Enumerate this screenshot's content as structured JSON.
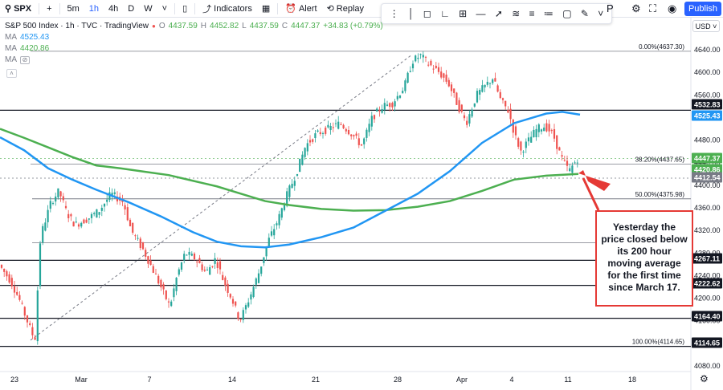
{
  "toolbar": {
    "symbol": "SPX",
    "intervals": [
      {
        "label": "5m"
      },
      {
        "label": "1h"
      },
      {
        "label": "4h"
      },
      {
        "label": "D"
      },
      {
        "label": "W"
      }
    ],
    "indicators_label": "Indicators",
    "alert_label": "Alert",
    "replay_label": "Replay",
    "publish_label": "Publish",
    "letter_p": "P"
  },
  "colors": {
    "accent": "#2962ff",
    "up": "#26a69a",
    "down": "#ef5350",
    "ma_fast": "#2196f3",
    "ma_slow": "#4caf50",
    "callout": "#e53935"
  },
  "legend": {
    "title": "S&P 500 Index · 1h · TVC · TradingView",
    "ohlc": {
      "o": "4437.59",
      "h": "4452.82",
      "l": "4437.59",
      "c": "4447.37",
      "chg": "+34.83 (+0.79%)"
    },
    "ma1": {
      "name": "MA",
      "value": "4525.43"
    },
    "ma2": {
      "name": "MA",
      "value": "4420.86"
    }
  },
  "currency": "USD",
  "annotation": "Yesterday the price closed below its 200 hour moving average for the first time since March 17.",
  "chart_data": {
    "type": "candlestick",
    "ylim": [
      4050,
      4660
    ],
    "x_ticks": [
      "23",
      "Mar",
      "7",
      "14",
      "21",
      "28",
      "Apr",
      "4",
      "11",
      "18"
    ],
    "y_ticks": [
      4640,
      4600,
      4560,
      4520,
      4480,
      4440,
      4400,
      4360,
      4320,
      4280,
      4240,
      4200,
      4160,
      4120,
      4080
    ],
    "fib_levels": [
      {
        "label": "0.00%(4637.30)",
        "value": 4637.3
      },
      {
        "label": "38.20%(4437.65)",
        "value": 4437.65
      },
      {
        "label": "50.00%(4375.98)",
        "value": 4375.98
      },
      {
        "label": "100.00%(4114.65)",
        "value": 4114.65
      }
    ],
    "horizontal_lines": [
      4532.83,
      4267.11,
      4222.62,
      4164.4,
      4114.65
    ],
    "price_labels": [
      {
        "text": "4532.83",
        "color": "#131722"
      },
      {
        "text": "4525.43",
        "color": "#2196f3"
      },
      {
        "text": "4447.37",
        "color": "#4caf50"
      },
      {
        "text": "4420.86",
        "color": "#4caf50"
      },
      {
        "text": "4412.54",
        "color": "#787b86"
      },
      {
        "text": "4267.11",
        "color": "#131722"
      },
      {
        "text": "4222.62",
        "color": "#131722"
      },
      {
        "text": "4164.40",
        "color": "#131722"
      },
      {
        "text": "4114.65",
        "color": "#131722"
      }
    ],
    "prices_path": [
      [
        0,
        4260
      ],
      [
        5,
        4250
      ],
      [
        15,
        4230
      ],
      [
        25,
        4200
      ],
      [
        38,
        4150
      ],
      [
        45,
        4125
      ],
      [
        52,
        4310
      ],
      [
        65,
        4370
      ],
      [
        75,
        4390
      ],
      [
        85,
        4350
      ],
      [
        95,
        4330
      ],
      [
        110,
        4340
      ],
      [
        125,
        4355
      ],
      [
        140,
        4385
      ],
      [
        155,
        4370
      ],
      [
        165,
        4320
      ],
      [
        180,
        4285
      ],
      [
        192,
        4250
      ],
      [
        205,
        4210
      ],
      [
        213,
        4185
      ],
      [
        222,
        4240
      ],
      [
        232,
        4280
      ],
      [
        245,
        4270
      ],
      [
        258,
        4245
      ],
      [
        270,
        4270
      ],
      [
        280,
        4230
      ],
      [
        290,
        4200
      ],
      [
        300,
        4160
      ],
      [
        312,
        4200
      ],
      [
        325,
        4250
      ],
      [
        335,
        4300
      ],
      [
        348,
        4340
      ],
      [
        358,
        4380
      ],
      [
        370,
        4420
      ],
      [
        382,
        4470
      ],
      [
        395,
        4490
      ],
      [
        410,
        4500
      ],
      [
        425,
        4510
      ],
      [
        440,
        4490
      ],
      [
        452,
        4470
      ],
      [
        465,
        4520
      ],
      [
        478,
        4540
      ],
      [
        490,
        4545
      ],
      [
        505,
        4575
      ],
      [
        515,
        4620
      ],
      [
        525,
        4630
      ],
      [
        535,
        4615
      ],
      [
        548,
        4600
      ],
      [
        560,
        4580
      ],
      [
        572,
        4540
      ],
      [
        582,
        4510
      ],
      [
        595,
        4560
      ],
      [
        605,
        4575
      ],
      [
        615,
        4590
      ],
      [
        625,
        4550
      ],
      [
        635,
        4530
      ],
      [
        642,
        4490
      ],
      [
        650,
        4460
      ],
      [
        660,
        4480
      ],
      [
        670,
        4500
      ],
      [
        680,
        4505
      ],
      [
        690,
        4490
      ],
      [
        700,
        4450
      ],
      [
        710,
        4425
      ],
      [
        720,
        4447
      ]
    ],
    "ma_fast": [
      [
        0,
        4485
      ],
      [
        30,
        4462
      ],
      [
        60,
        4430
      ],
      [
        90,
        4410
      ],
      [
        120,
        4392
      ],
      [
        160,
        4370
      ],
      [
        200,
        4345
      ],
      [
        240,
        4317
      ],
      [
        270,
        4300
      ],
      [
        300,
        4292
      ],
      [
        330,
        4290
      ],
      [
        360,
        4295
      ],
      [
        400,
        4308
      ],
      [
        440,
        4325
      ],
      [
        480,
        4355
      ],
      [
        520,
        4385
      ],
      [
        560,
        4425
      ],
      [
        600,
        4475
      ],
      [
        640,
        4510
      ],
      [
        680,
        4527
      ],
      [
        700,
        4530
      ],
      [
        722,
        4525
      ]
    ],
    "ma_slow": [
      [
        0,
        4500
      ],
      [
        30,
        4484
      ],
      [
        60,
        4467
      ],
      [
        90,
        4450
      ],
      [
        120,
        4435
      ],
      [
        150,
        4430
      ],
      [
        180,
        4424
      ],
      [
        210,
        4418
      ],
      [
        240,
        4408
      ],
      [
        270,
        4398
      ],
      [
        300,
        4385
      ],
      [
        330,
        4372
      ],
      [
        360,
        4365
      ],
      [
        400,
        4358
      ],
      [
        440,
        4355
      ],
      [
        480,
        4356
      ],
      [
        520,
        4362
      ],
      [
        560,
        4372
      ],
      [
        600,
        4390
      ],
      [
        640,
        4410
      ],
      [
        680,
        4417
      ],
      [
        720,
        4420
      ]
    ]
  }
}
